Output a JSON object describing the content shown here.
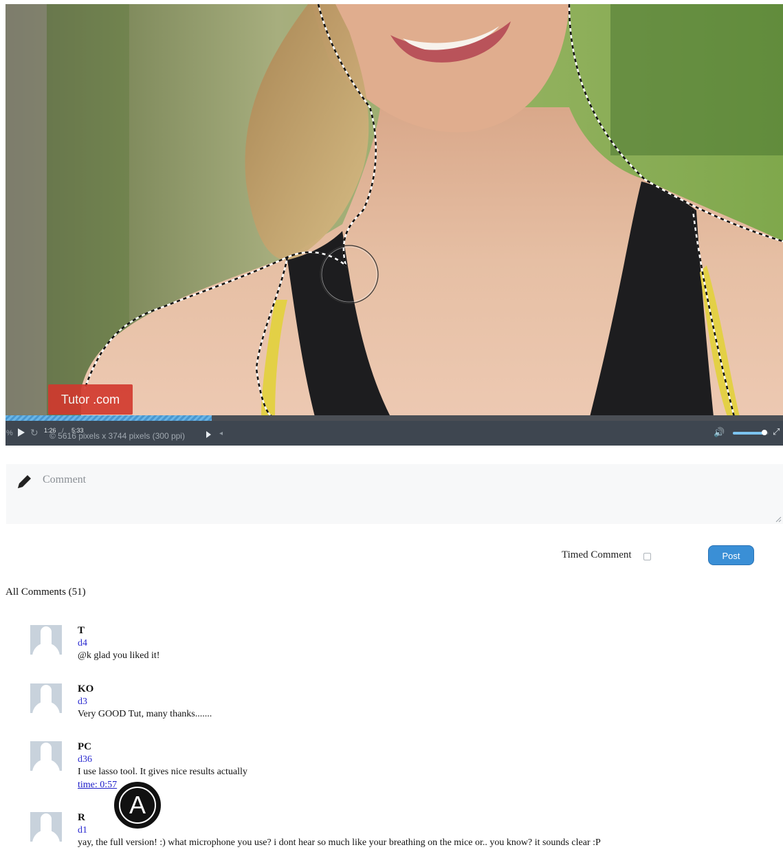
{
  "video": {
    "watermark": "Tutor  .com",
    "status_text": "© 5616 pixels x 3744 pixels (300 ppi)",
    "zoom_fragment": "%",
    "current_time": "1:26",
    "time_separator": "/",
    "duration": "5:33",
    "progress_fraction": 0.265,
    "volume_fraction": 0.88
  },
  "composer": {
    "placeholder": "Comment",
    "timed_comment_label": "Timed Comment",
    "post_label": "Post"
  },
  "comments_header": "All Comments (51)",
  "comments": [
    {
      "name": "T",
      "date": "d4",
      "text": "@k glad you liked it!",
      "time": ""
    },
    {
      "name": "KO",
      "date": "d3",
      "text": "Very GOOD Tut, many thanks.......",
      "time": ""
    },
    {
      "name": "PC",
      "date": "d36",
      "text": "I use lasso tool. It gives nice results actually",
      "time": "time: 0:57"
    },
    {
      "name": "R",
      "date": "d1",
      "text": "yay, the full version! :) what microphone you use? i dont hear so much like your breathing on the mice or.. you know? it sounds clear :P",
      "time": ""
    }
  ],
  "badge": {
    "letter": "A"
  },
  "colors": {
    "accent": "#3a8fd6",
    "progress": "#5fa9dd",
    "controls_bg": "#3e4650",
    "watermark": "#d2382d"
  }
}
